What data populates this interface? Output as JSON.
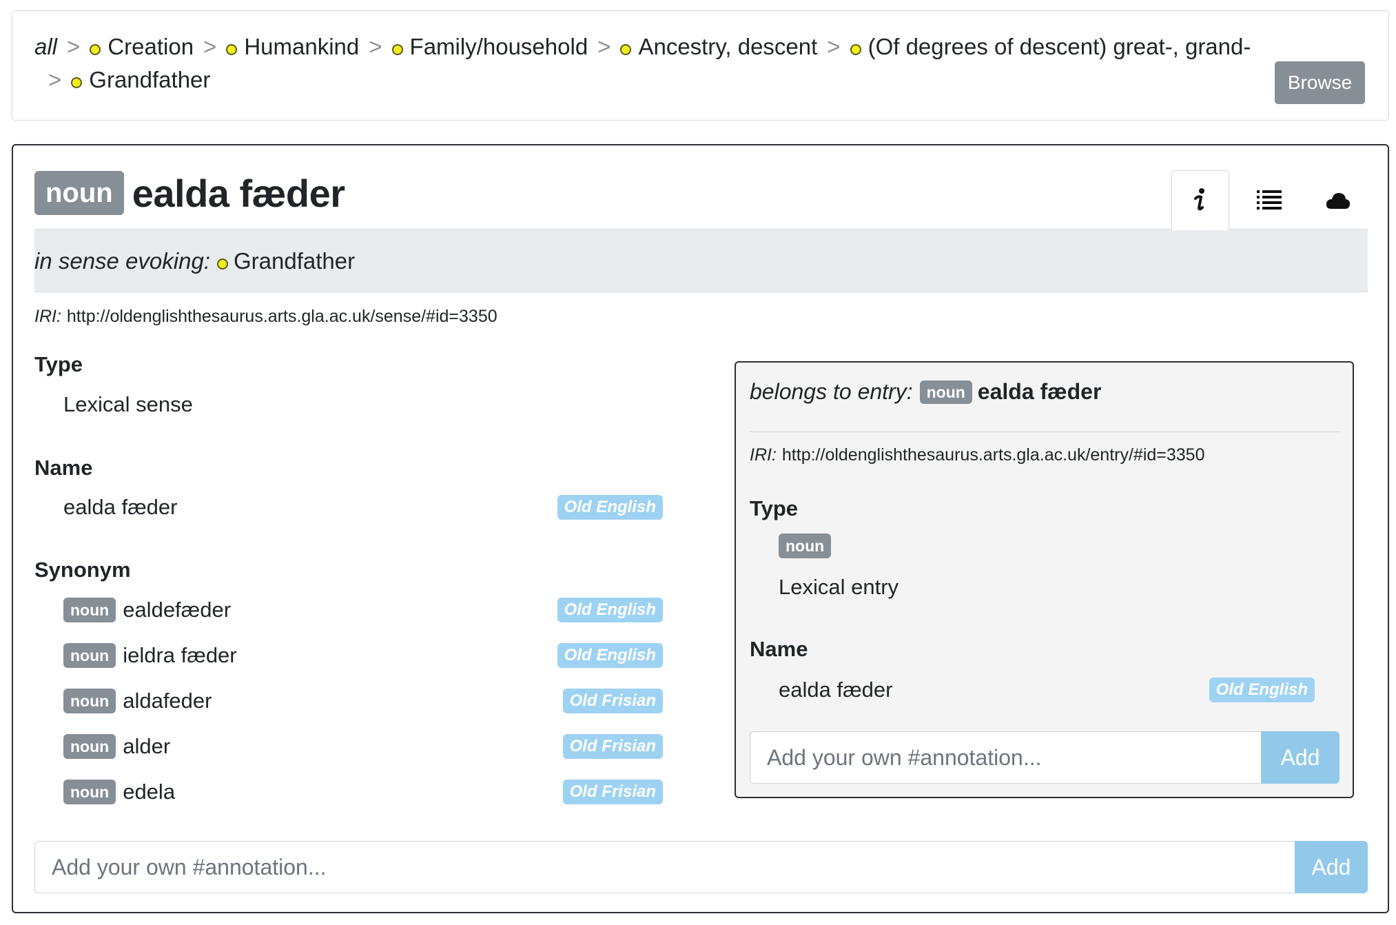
{
  "breadcrumb": {
    "root": "all",
    "separator": ">",
    "items": [
      "Creation",
      "Humankind",
      "Family/household",
      "Ancestry, descent",
      "(Of degrees of descent) great-, grand-",
      "Grandfather"
    ],
    "browse_label": "Browse"
  },
  "header": {
    "pos": "noun",
    "title": "ealda fæder",
    "tabs": [
      "info-icon",
      "list-icon",
      "cloud-icon"
    ]
  },
  "evokes": {
    "label": "in sense evoking:",
    "value": "Grandfather"
  },
  "iri": {
    "label": "IRI:",
    "value": "http://oldenglishthesaurus.arts.gla.ac.uk/sense/#id=3350"
  },
  "sense": {
    "type_label": "Type",
    "type_value": "Lexical sense",
    "name_label": "Name",
    "name_value": "ealda fæder",
    "name_lang": "Old English",
    "synonym_label": "Synonym",
    "synonyms": [
      {
        "pos": "noun",
        "word": "ealdefæder",
        "lang": "Old English"
      },
      {
        "pos": "noun",
        "word": "ieldra fæder",
        "lang": "Old English"
      },
      {
        "pos": "noun",
        "word": "aldafeder",
        "lang": "Old Frisian"
      },
      {
        "pos": "noun",
        "word": "alder",
        "lang": "Old Frisian"
      },
      {
        "pos": "noun",
        "word": "edela",
        "lang": "Old Frisian"
      }
    ]
  },
  "entry": {
    "label": "belongs to entry:",
    "pos": "noun",
    "word": "ealda fæder",
    "iri_label": "IRI:",
    "iri_value": "http://oldenglishthesaurus.arts.gla.ac.uk/entry/#id=3350",
    "type_label": "Type",
    "type_pos": "noun",
    "type_value": "Lexical entry",
    "name_label": "Name",
    "name_value": "ealda fæder",
    "name_lang": "Old English",
    "annotation_placeholder": "Add your own #annotation...",
    "add_label": "Add"
  },
  "annotation": {
    "placeholder": "Add your own #annotation...",
    "add_label": "Add"
  },
  "colors": {
    "pos_badge": "#868e96",
    "lang_badge": "#9ed2f2",
    "add_button": "#92c9ea",
    "sense_dot": "#f2f01e"
  }
}
